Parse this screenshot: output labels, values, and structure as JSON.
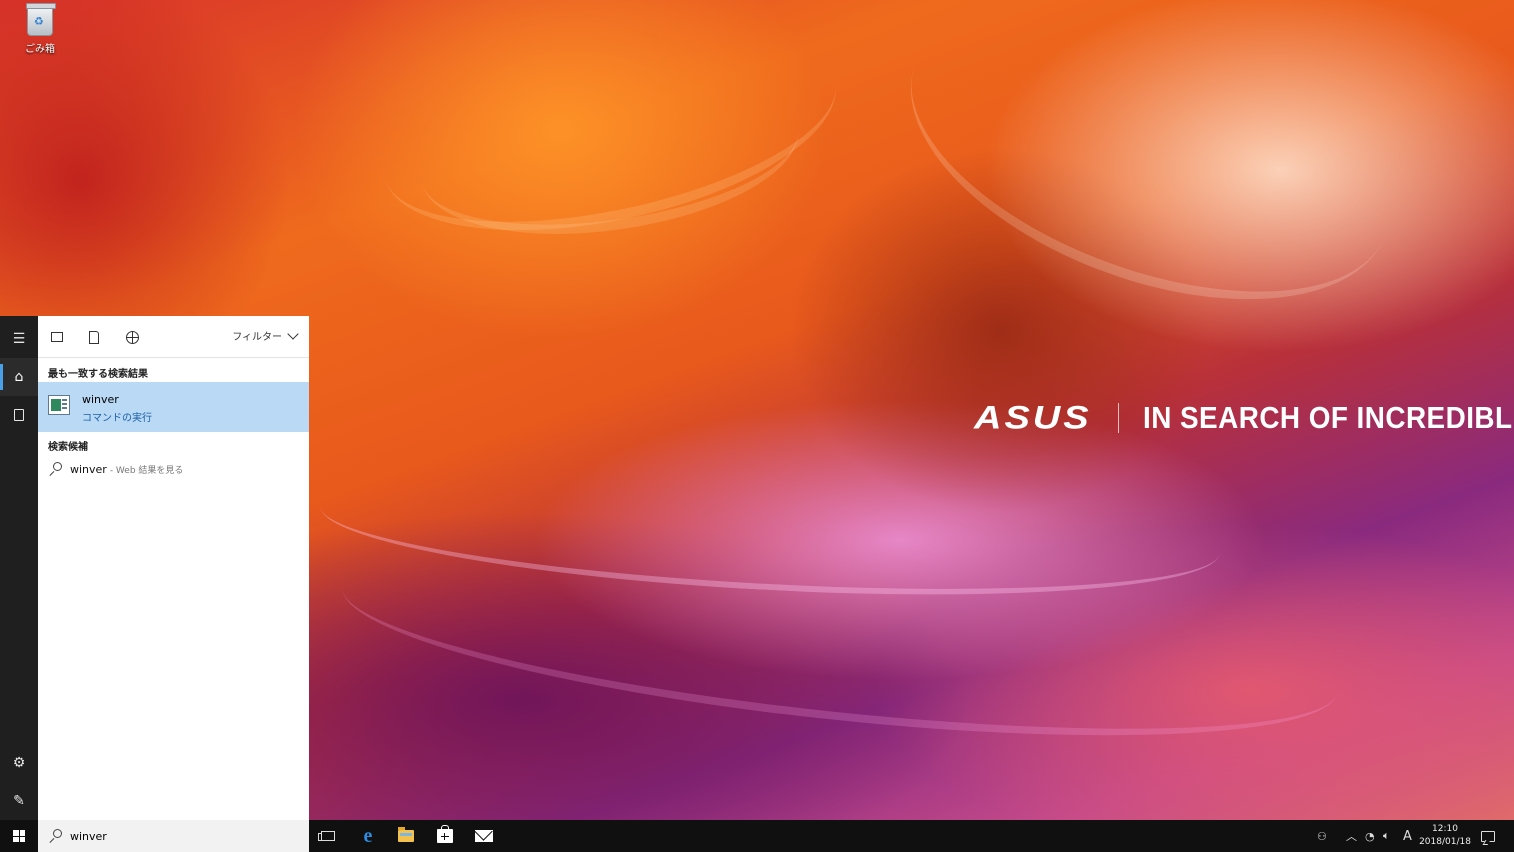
{
  "desktop": {
    "recycle_bin_label": "ごみ箱",
    "brand_logo": "ASUS",
    "brand_tagline": "IN SEARCH OF INCREDIBLE"
  },
  "side_rail": {
    "icons": [
      "hamburger-icon",
      "home-icon",
      "notebook-icon",
      "gear-icon",
      "feedback-icon"
    ]
  },
  "search_panel": {
    "toolbar": {
      "filter_label": "フィルター",
      "icons": [
        "apps-icon",
        "document-icon",
        "web-globe-icon"
      ]
    },
    "best_match": {
      "header": "最も一致する検索結果",
      "title": "winver",
      "subtitle": "コマンドの実行"
    },
    "suggestions": {
      "header": "検索候補",
      "items": [
        {
          "term": "winver",
          "hint": "- Web 結果を見る"
        }
      ]
    }
  },
  "taskbar": {
    "search_value": "winver",
    "pinned": [
      "task-view-icon",
      "edge-icon",
      "file-explorer-icon",
      "store-icon",
      "mail-icon"
    ],
    "tray": {
      "ime_label": "A",
      "time": "12:10",
      "date": "2018/01/18"
    }
  },
  "colors": {
    "accent": "#4aa0e6",
    "selection": "#b9d9f5",
    "taskbar": "#101010",
    "rail": "#1f1f1f"
  }
}
